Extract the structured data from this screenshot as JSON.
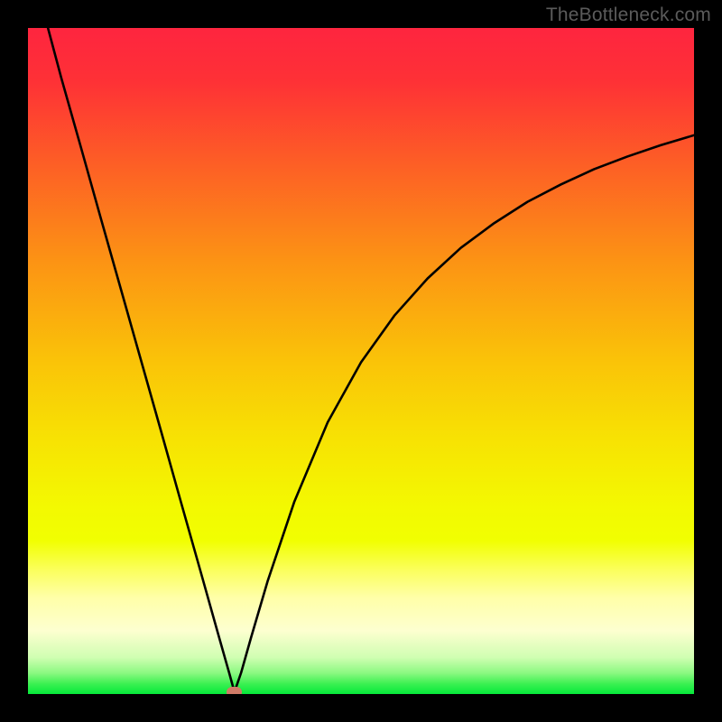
{
  "watermark": "TheBottleneck.com",
  "chart_data": {
    "type": "line",
    "title": "",
    "xlabel": "",
    "ylabel": "",
    "xlim": [
      0,
      100
    ],
    "ylim": [
      0,
      100
    ],
    "grid": false,
    "series": [
      {
        "name": "curve-left",
        "x": [
          3.0,
          5.0,
          8.0,
          11.0,
          14.0,
          17.0,
          20.0,
          23.0,
          26.0,
          28.5,
          30.2,
          31.0
        ],
        "y": [
          100.0,
          92.5,
          81.9,
          71.2,
          60.6,
          50.0,
          39.4,
          28.7,
          18.1,
          9.2,
          3.2,
          0.3
        ]
      },
      {
        "name": "curve-right",
        "x": [
          31.0,
          32.0,
          33.5,
          36.0,
          40.0,
          45.0,
          50.0,
          55.0,
          60.0,
          65.0,
          70.0,
          75.0,
          80.0,
          85.0,
          90.0,
          95.0,
          100.0
        ],
        "y": [
          0.3,
          3.2,
          8.5,
          17.0,
          28.9,
          40.8,
          49.8,
          56.8,
          62.4,
          67.0,
          70.7,
          73.9,
          76.5,
          78.8,
          80.7,
          82.4,
          83.9
        ]
      }
    ],
    "marker": {
      "x": 31.0,
      "y": 0.3,
      "color": "#cf7b67"
    },
    "gradient_stops": [
      {
        "pos": 0.0,
        "color": "#fe253f"
      },
      {
        "pos": 0.08,
        "color": "#fe3136"
      },
      {
        "pos": 0.2,
        "color": "#fd5d26"
      },
      {
        "pos": 0.35,
        "color": "#fc9314"
      },
      {
        "pos": 0.5,
        "color": "#fac308"
      },
      {
        "pos": 0.62,
        "color": "#f7e303"
      },
      {
        "pos": 0.72,
        "color": "#f3f901"
      },
      {
        "pos": 0.77,
        "color": "#f1ff01"
      },
      {
        "pos": 0.815,
        "color": "#fbff5f"
      },
      {
        "pos": 0.855,
        "color": "#ffffa8"
      },
      {
        "pos": 0.905,
        "color": "#fdffd0"
      },
      {
        "pos": 0.945,
        "color": "#d0feb2"
      },
      {
        "pos": 0.968,
        "color": "#8df982"
      },
      {
        "pos": 0.985,
        "color": "#3af051"
      },
      {
        "pos": 1.0,
        "color": "#06e93a"
      }
    ]
  }
}
